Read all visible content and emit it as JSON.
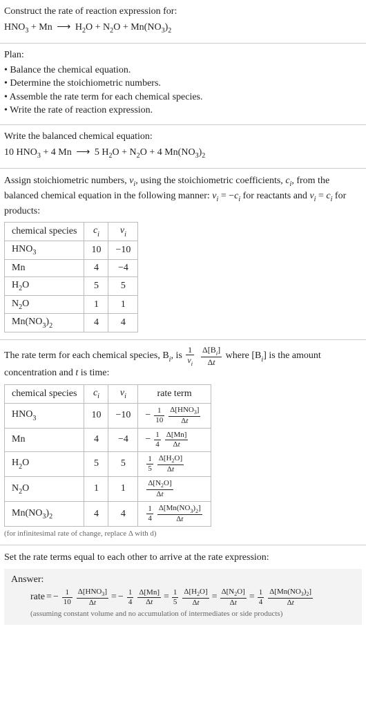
{
  "intro": {
    "prompt": "Construct the rate of reaction expression for:",
    "equation_parts": {
      "r1": "HNO",
      "r1s": "3",
      "plus1": " + ",
      "r2": "Mn",
      "arrow": " ⟶ ",
      "p1": "H",
      "p1s": "2",
      "p1b": "O",
      "plus2": " + ",
      "p2": "N",
      "p2s": "2",
      "p2b": "O",
      "plus3": " + ",
      "p3": "Mn(NO",
      "p3s": "3",
      "p3b": ")",
      "p3s2": "2"
    }
  },
  "plan": {
    "heading": "Plan:",
    "items": [
      "• Balance the chemical equation.",
      "• Determine the stoichiometric numbers.",
      "• Assemble the rate term for each chemical species.",
      "• Write the rate of reaction expression."
    ]
  },
  "balanced": {
    "heading": "Write the balanced chemical equation:",
    "parts": {
      "c1": "10 ",
      "r1": "HNO",
      "r1s": "3",
      "plus1": " + ",
      "c2": "4 ",
      "r2": "Mn",
      "arrow": " ⟶ ",
      "c3": "5 ",
      "p1": "H",
      "p1s": "2",
      "p1b": "O",
      "plus2": " + ",
      "p2": "N",
      "p2s": "2",
      "p2b": "O",
      "plus3": " + ",
      "c4": "4 ",
      "p3": "Mn(NO",
      "p3s": "3",
      "p3b": ")",
      "p3s2": "2"
    }
  },
  "stoich": {
    "para_a": "Assign stoichiometric numbers, ",
    "nu": "ν",
    "isub": "i",
    "para_b": ", using the stoichiometric coefficients, ",
    "ci": "c",
    "para_c": ", from the balanced chemical equation in the following manner: ",
    "eq1a": "ν",
    "eq1b": " = −",
    "eq1c": "c",
    "para_d": " for reactants and ",
    "eq2a": "ν",
    "eq2b": " = ",
    "eq2c": "c",
    "para_e": " for products:",
    "headers": [
      "chemical species",
      "cᵢ",
      "νᵢ"
    ],
    "h0": "chemical species",
    "h1_a": "c",
    "h1_b": "i",
    "h2_a": "ν",
    "h2_b": "i",
    "rows": [
      {
        "sp_a": "HNO",
        "sp_s": "3",
        "sp_b": "",
        "ci": "10",
        "nui": "−10"
      },
      {
        "sp_a": "Mn",
        "sp_s": "",
        "sp_b": "",
        "ci": "4",
        "nui": "−4"
      },
      {
        "sp_a": "H",
        "sp_s": "2",
        "sp_b": "O",
        "ci": "5",
        "nui": "5"
      },
      {
        "sp_a": "N",
        "sp_s": "2",
        "sp_b": "O",
        "ci": "1",
        "nui": "1"
      },
      {
        "sp_a": "Mn(NO",
        "sp_s": "3",
        "sp_b": ")",
        "sp_s2": "2",
        "ci": "4",
        "nui": "4"
      }
    ]
  },
  "rateterm": {
    "para_a": "The rate term for each chemical species, B",
    "para_b": ", is ",
    "frac1_num": "1",
    "frac1_den_a": "ν",
    "frac1_den_b": "i",
    "frac2_num_a": "Δ[B",
    "frac2_num_b": "i",
    "frac2_num_c": "]",
    "frac2_den": "Δt",
    "para_c": " where [B",
    "para_d": "] is the amount concentration and ",
    "tvar": "t",
    "para_e": " is time:",
    "h0": "chemical species",
    "h1_a": "c",
    "h1_b": "i",
    "h2_a": "ν",
    "h2_b": "i",
    "h3": "rate term",
    "rows": [
      {
        "sp_a": "HNO",
        "sp_s": "3",
        "sp_b": "",
        "ci": "10",
        "nui": "−10",
        "neg": "−",
        "fn": "1",
        "fd": "10",
        "dn": "Δ[HNO",
        "ds": "3",
        "dn2": "]",
        "dd": "Δt"
      },
      {
        "sp_a": "Mn",
        "sp_s": "",
        "sp_b": "",
        "ci": "4",
        "nui": "−4",
        "neg": "−",
        "fn": "1",
        "fd": "4",
        "dn": "Δ[Mn]",
        "ds": "",
        "dn2": "",
        "dd": "Δt"
      },
      {
        "sp_a": "H",
        "sp_s": "2",
        "sp_b": "O",
        "ci": "5",
        "nui": "5",
        "neg": "",
        "fn": "1",
        "fd": "5",
        "dn": "Δ[H",
        "ds": "2",
        "dn2": "O]",
        "dd": "Δt"
      },
      {
        "sp_a": "N",
        "sp_s": "2",
        "sp_b": "O",
        "ci": "1",
        "nui": "1",
        "neg": "",
        "fn": "",
        "fd": "",
        "dn": "Δ[N",
        "ds": "2",
        "dn2": "O]",
        "dd": "Δt"
      },
      {
        "sp_a": "Mn(NO",
        "sp_s": "3",
        "sp_b": ")",
        "sp_s2": "2",
        "ci": "4",
        "nui": "4",
        "neg": "",
        "fn": "1",
        "fd": "4",
        "dn": "Δ[Mn(NO",
        "ds": "3",
        "dn2": ")",
        "ds2": "2",
        "dn3": "]",
        "dd": "Δt"
      }
    ],
    "note": "(for infinitesimal rate of change, replace Δ with d)"
  },
  "final": {
    "heading": "Set the rate terms equal to each other to arrive at the rate expression:",
    "answer_label": "Answer:",
    "rate_word": "rate",
    "eq": " = ",
    "terms": [
      {
        "neg": "−",
        "fn": "1",
        "fd": "10",
        "dn": "Δ[HNO",
        "ds": "3",
        "dn2": "]",
        "dd": "Δt"
      },
      {
        "neg": "−",
        "fn": "1",
        "fd": "4",
        "dn": "Δ[Mn]",
        "ds": "",
        "dn2": "",
        "dd": "Δt"
      },
      {
        "neg": "",
        "fn": "1",
        "fd": "5",
        "dn": "Δ[H",
        "ds": "2",
        "dn2": "O]",
        "dd": "Δt"
      },
      {
        "neg": "",
        "fn": "",
        "fd": "",
        "dn": "Δ[N",
        "ds": "2",
        "dn2": "O]",
        "dd": "Δt"
      },
      {
        "neg": "",
        "fn": "1",
        "fd": "4",
        "dn": "Δ[Mn(NO",
        "ds": "3",
        "dn2": ")",
        "ds2": "2",
        "dn3": "]",
        "dd": "Δt"
      }
    ],
    "assume": "(assuming constant volume and no accumulation of intermediates or side products)"
  }
}
